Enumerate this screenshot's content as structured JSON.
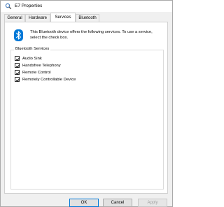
{
  "window": {
    "title": "E7 Properties"
  },
  "tabs": [
    {
      "label": "General",
      "active": false
    },
    {
      "label": "Hardware",
      "active": false
    },
    {
      "label": "Services",
      "active": true
    },
    {
      "label": "Bluetooth",
      "active": false
    }
  ],
  "services_page": {
    "info_text": "This Bluetooth device offers the following services. To use a service, select the check box.",
    "group_label": "Bluetooth Services",
    "services": [
      {
        "label": "Audio Sink",
        "checked": true
      },
      {
        "label": "Handsfree Telephony",
        "checked": true
      },
      {
        "label": "Remote Control",
        "checked": true
      },
      {
        "label": "Remotely Controllable Device",
        "checked": true
      }
    ]
  },
  "buttons": {
    "ok": "OK",
    "cancel": "Cancel",
    "apply": "Apply"
  },
  "colors": {
    "bluetooth": "#0078d7",
    "default_button_border": "#0078d7"
  }
}
